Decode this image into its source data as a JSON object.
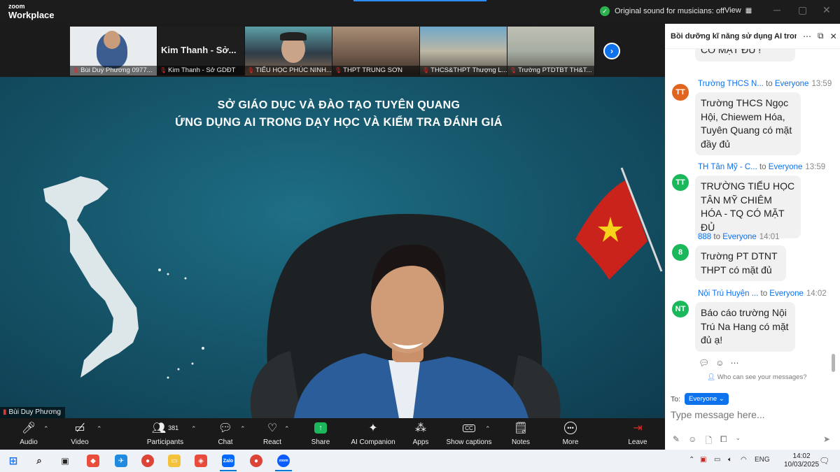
{
  "app": {
    "brand_small": "zoom",
    "brand_name": "Workplace"
  },
  "topbar": {
    "sound_status": "Original sound for musicians: off",
    "view_label": "View"
  },
  "gallery": {
    "big_name": "Kim Thanh - Sở...",
    "tiles": [
      {
        "label": "Bùi Duy Phương 0977..."
      },
      {
        "label": "Kim Thanh - Sở GDĐT"
      },
      {
        "label": "TIỂU HỌC PHÚC NINH..."
      },
      {
        "label": "THPT TRUNG SƠN"
      },
      {
        "label": "THCS&THPT Thượng L..."
      },
      {
        "label": "Trường PTDTBT TH&T..."
      }
    ]
  },
  "stage": {
    "title_line1": "SỞ GIÁO DỤC VÀ ĐÀO TẠO TUYÊN QUANG",
    "title_line2": "ỨNG DỤNG AI TRONG DẠY HỌC VÀ KIỂM TRA ĐÁNH GIÁ",
    "speaker": "Bùi Duy Phương"
  },
  "toolbar": {
    "audio": "Audio",
    "video": "Video",
    "participants": "Participants",
    "participants_count": "381",
    "chat": "Chat",
    "react": "React",
    "share": "Share",
    "ai_companion": "AI Companion",
    "apps": "Apps",
    "captions": "Show captions",
    "notes": "Notes",
    "more": "More",
    "leave": "Leave"
  },
  "chat": {
    "header_title": "Bồi dưỡng kĩ năng sử dụng AI tron...",
    "partial_message": {
      "text": "CÓ MẶT ĐỦ !"
    },
    "messages": [
      {
        "initials": "TT",
        "avatar_color": "#e0661f",
        "sender": "Trường THCS N...",
        "to": "to",
        "recipient": "Everyone",
        "time": "13:59",
        "text": "Trường THCS Ngọc Hội, Chiewem Hóa, Tuyên Quang có mặt đầy đủ"
      },
      {
        "initials": "TT",
        "avatar_color": "#1ab85a",
        "sender": "TH Tân Mỹ - C...",
        "to": "to",
        "recipient": "Everyone",
        "time": "13:59",
        "text": "TRƯỜNG TIỂU HỌC TÂN MỸ CHIÊM HÓA - TQ CÓ MẶT ĐỦ"
      },
      {
        "initials": "8",
        "avatar_color": "#1ab85a",
        "sender": "888",
        "to": "to",
        "recipient": "Everyone",
        "time": "14:01",
        "text": "Trường PT DTNT THPT có mặt đủ"
      },
      {
        "initials": "NT",
        "avatar_color": "#1ab85a",
        "sender": "Nội Trú Huyện ...",
        "to": "to",
        "recipient": "Everyone",
        "time": "14:02",
        "text": "Báo cáo trường Nội Trú Na Hang có mặt đủ ạ!"
      }
    ],
    "who_can_see": "Who can see your messages?",
    "to_label": "To:",
    "recipient_button": "Everyone",
    "input_placeholder": "Type message here..."
  },
  "taskbar": {
    "lang": "ENG",
    "time": "14:02",
    "date": "10/03/2025",
    "zalo_label": "Zalo",
    "zoom_label": "zoom"
  }
}
